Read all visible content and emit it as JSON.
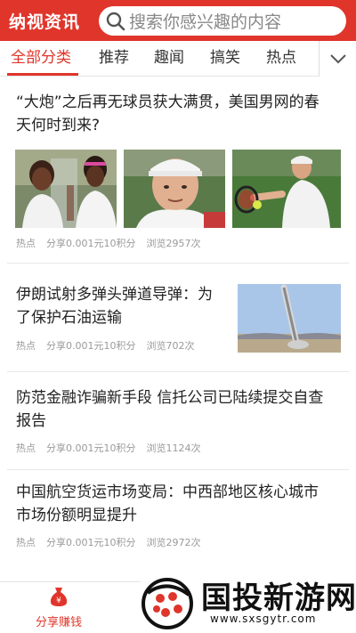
{
  "header": {
    "brand": "纳视资讯",
    "search_placeholder": "搜索你感兴趣的内容",
    "colors": {
      "brand_red": "#e0352b"
    }
  },
  "tabs": [
    {
      "label": "全部分类",
      "active": true
    },
    {
      "label": "推荐",
      "active": false
    },
    {
      "label": "趣闻",
      "active": false
    },
    {
      "label": "搞笑",
      "active": false
    },
    {
      "label": "热点",
      "active": false
    }
  ],
  "articles": [
    {
      "title_line1": "“大炮”之后再无球员获大满贯，美国男网的春",
      "title_line2": "天何时到来?",
      "tag": "热点",
      "share": "分享0.001元10积分",
      "views": "浏览2957次"
    },
    {
      "title_line1": "伊朗试射多弹头弹道导弹：为",
      "title_line2": "了保护石油运输",
      "tag": "热点",
      "share": "分享0.001元10积分",
      "views": "浏览702次"
    },
    {
      "title_line1": "防范金融诈骗新手段 信托公司已陆续提交自查",
      "title_line2": "报告",
      "tag": "热点",
      "share": "分享0.001元10积分",
      "views": "浏览1124次"
    },
    {
      "title_line1": "中国航空货运市场变局：中西部地区核心城市",
      "title_line2": "市场份额明显提升",
      "tag": "热点",
      "share": "分享0.001元10积分",
      "views": "浏览2972次"
    }
  ],
  "bottom_nav": {
    "share_label": "分享赚钱",
    "share_icon": "money-bag-icon"
  },
  "watermark": {
    "text": "国投新游网",
    "url": "www.sxsgytr.com"
  }
}
